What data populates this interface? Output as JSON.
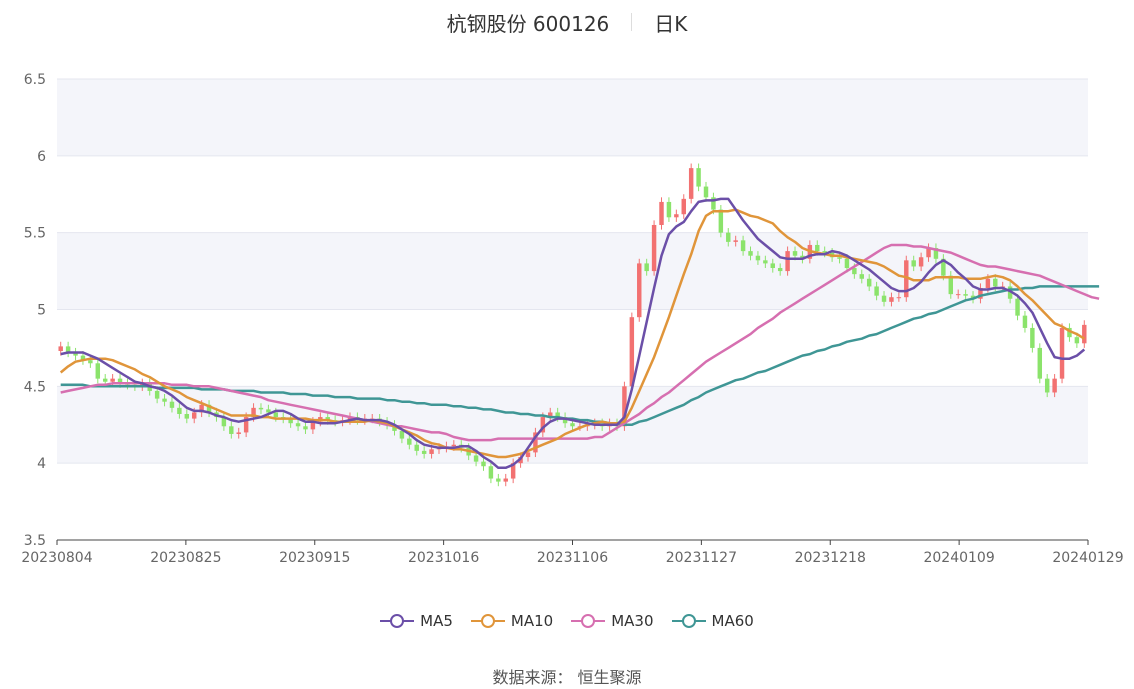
{
  "header": {
    "title": "杭钢股份 600126",
    "period": "日K"
  },
  "source": "数据来源： 恒生聚源",
  "colors": {
    "up": "#f27171",
    "down": "#8be36b",
    "ma5": "#6b4fa8",
    "ma10": "#e0953a",
    "ma30": "#d66fb0",
    "ma60": "#3f9695",
    "grid": "#e4e6ef",
    "band": "#f4f5fa"
  },
  "chart_data": {
    "type": "candlestick",
    "title": "杭钢股份 600126 日K",
    "ylim": [
      3.5,
      6.5
    ],
    "yticks": [
      "3.5",
      "4",
      "4.5",
      "5",
      "5.5",
      "6",
      "6.5"
    ],
    "xticks": [
      "20230804",
      "20230825",
      "20230915",
      "20231016",
      "20231106",
      "20231127",
      "20231218",
      "20240109",
      "20240129"
    ],
    "legend": [
      "MA5",
      "MA10",
      "MA30",
      "MA60"
    ],
    "close": [
      4.76,
      4.72,
      4.7,
      4.67,
      4.65,
      4.55,
      4.53,
      4.55,
      4.52,
      4.51,
      4.5,
      4.52,
      4.47,
      4.42,
      4.4,
      4.36,
      4.32,
      4.29,
      4.33,
      4.38,
      4.33,
      4.3,
      4.24,
      4.19,
      4.2,
      4.3,
      4.36,
      4.35,
      4.33,
      4.3,
      4.29,
      4.26,
      4.24,
      4.22,
      4.27,
      4.3,
      4.28,
      4.27,
      4.28,
      4.3,
      4.28,
      4.29,
      4.29,
      4.27,
      4.25,
      4.21,
      4.16,
      4.12,
      4.08,
      4.06,
      4.09,
      4.1,
      4.11,
      4.12,
      4.1,
      4.05,
      4.01,
      3.98,
      3.9,
      3.88,
      3.9,
      4.0,
      4.04,
      4.07,
      4.2,
      4.3,
      4.33,
      4.3,
      4.26,
      4.24,
      4.24,
      4.25,
      4.26,
      4.24,
      4.26,
      4.24,
      4.5,
      4.95,
      5.3,
      5.25,
      5.55,
      5.7,
      5.6,
      5.62,
      5.72,
      5.92,
      5.8,
      5.73,
      5.65,
      5.5,
      5.44,
      5.45,
      5.38,
      5.35,
      5.32,
      5.3,
      5.27,
      5.25,
      5.38,
      5.35,
      5.33,
      5.42,
      5.38,
      5.37,
      5.34,
      5.33,
      5.27,
      5.23,
      5.2,
      5.15,
      5.09,
      5.05,
      5.08,
      5.08,
      5.32,
      5.28,
      5.34,
      5.4,
      5.33,
      5.22,
      5.1,
      5.1,
      5.09,
      5.07,
      5.14,
      5.2,
      5.15,
      5.15,
      5.07,
      4.96,
      4.88,
      4.75,
      4.55,
      4.46,
      4.55,
      4.88,
      4.82,
      4.78,
      4.9
    ],
    "ma5": [
      4.71,
      4.72,
      4.72,
      4.72,
      4.7,
      4.68,
      4.65,
      4.62,
      4.59,
      4.56,
      4.53,
      4.52,
      4.5,
      4.49,
      4.47,
      4.44,
      4.4,
      4.36,
      4.34,
      4.34,
      4.33,
      4.31,
      4.3,
      4.28,
      4.27,
      4.28,
      4.29,
      4.3,
      4.32,
      4.34,
      4.34,
      4.32,
      4.29,
      4.27,
      4.27,
      4.26,
      4.26,
      4.26,
      4.27,
      4.28,
      4.29,
      4.28,
      4.28,
      4.28,
      4.27,
      4.25,
      4.22,
      4.19,
      4.15,
      4.12,
      4.11,
      4.1,
      4.1,
      4.1,
      4.11,
      4.11,
      4.08,
      4.04,
      4.01,
      3.97,
      3.97,
      3.99,
      4.03,
      4.1,
      4.17,
      4.23,
      4.27,
      4.29,
      4.29,
      4.28,
      4.27,
      4.26,
      4.25,
      4.25,
      4.25,
      4.25,
      4.3,
      4.48,
      4.7,
      4.92,
      5.14,
      5.35,
      5.49,
      5.54,
      5.57,
      5.64,
      5.7,
      5.71,
      5.71,
      5.72,
      5.72,
      5.65,
      5.58,
      5.52,
      5.46,
      5.42,
      5.38,
      5.34,
      5.33,
      5.33,
      5.33,
      5.35,
      5.36,
      5.36,
      5.38,
      5.37,
      5.35,
      5.32,
      5.29,
      5.26,
      5.22,
      5.18,
      5.14,
      5.12,
      5.12,
      5.14,
      5.18,
      5.24,
      5.29,
      5.32,
      5.29,
      5.24,
      5.2,
      5.15,
      5.13,
      5.13,
      5.14,
      5.14,
      5.12,
      5.09,
      5.04,
      4.98,
      4.88,
      4.78,
      4.69,
      4.68,
      4.68,
      4.7,
      4.74
    ],
    "ma10": [
      4.59,
      4.63,
      4.66,
      4.67,
      4.68,
      4.68,
      4.68,
      4.67,
      4.65,
      4.63,
      4.61,
      4.58,
      4.56,
      4.53,
      4.5,
      4.48,
      4.46,
      4.43,
      4.41,
      4.39,
      4.37,
      4.35,
      4.33,
      4.31,
      4.31,
      4.31,
      4.31,
      4.3,
      4.3,
      4.29,
      4.29,
      4.29,
      4.29,
      4.29,
      4.28,
      4.28,
      4.28,
      4.27,
      4.27,
      4.27,
      4.27,
      4.27,
      4.28,
      4.27,
      4.26,
      4.24,
      4.22,
      4.2,
      4.18,
      4.15,
      4.13,
      4.12,
      4.1,
      4.09,
      4.09,
      4.08,
      4.07,
      4.06,
      4.05,
      4.04,
      4.04,
      4.05,
      4.06,
      4.08,
      4.1,
      4.12,
      4.14,
      4.16,
      4.19,
      4.21,
      4.23,
      4.25,
      4.26,
      4.27,
      4.26,
      4.26,
      4.27,
      4.36,
      4.47,
      4.58,
      4.69,
      4.82,
      4.95,
      5.09,
      5.23,
      5.36,
      5.51,
      5.61,
      5.64,
      5.64,
      5.64,
      5.65,
      5.63,
      5.61,
      5.6,
      5.58,
      5.56,
      5.51,
      5.47,
      5.44,
      5.4,
      5.38,
      5.37,
      5.36,
      5.35,
      5.35,
      5.34,
      5.33,
      5.32,
      5.31,
      5.3,
      5.28,
      5.25,
      5.22,
      5.21,
      5.19,
      5.19,
      5.19,
      5.21,
      5.21,
      5.21,
      5.21,
      5.2,
      5.2,
      5.2,
      5.21,
      5.22,
      5.21,
      5.19,
      5.15,
      5.1,
      5.06,
      5.01,
      4.96,
      4.91,
      4.89,
      4.86,
      4.84,
      4.81
    ],
    "ma30": [
      4.46,
      4.47,
      4.48,
      4.49,
      4.5,
      4.51,
      4.51,
      4.52,
      4.52,
      4.52,
      4.52,
      4.52,
      4.52,
      4.52,
      4.52,
      4.51,
      4.51,
      4.51,
      4.5,
      4.5,
      4.5,
      4.49,
      4.48,
      4.47,
      4.46,
      4.45,
      4.44,
      4.43,
      4.41,
      4.4,
      4.39,
      4.38,
      4.37,
      4.36,
      4.35,
      4.34,
      4.33,
      4.32,
      4.31,
      4.3,
      4.29,
      4.28,
      4.27,
      4.26,
      4.25,
      4.24,
      4.24,
      4.23,
      4.22,
      4.21,
      4.2,
      4.2,
      4.19,
      4.17,
      4.16,
      4.15,
      4.15,
      4.15,
      4.15,
      4.16,
      4.16,
      4.16,
      4.16,
      4.16,
      4.16,
      4.16,
      4.16,
      4.16,
      4.16,
      4.16,
      4.16,
      4.16,
      4.17,
      4.17,
      4.2,
      4.23,
      4.26,
      4.29,
      4.32,
      4.36,
      4.39,
      4.43,
      4.46,
      4.5,
      4.54,
      4.58,
      4.62,
      4.66,
      4.69,
      4.72,
      4.75,
      4.78,
      4.81,
      4.84,
      4.88,
      4.91,
      4.94,
      4.98,
      5.01,
      5.04,
      5.07,
      5.1,
      5.13,
      5.16,
      5.19,
      5.22,
      5.25,
      5.28,
      5.31,
      5.34,
      5.37,
      5.4,
      5.42,
      5.42,
      5.42,
      5.41,
      5.41,
      5.4,
      5.39,
      5.38,
      5.37,
      5.35,
      5.33,
      5.31,
      5.29,
      5.28,
      5.28,
      5.27,
      5.26,
      5.25,
      5.24,
      5.23,
      5.22,
      5.2,
      5.18,
      5.16,
      5.14,
      5.12,
      5.1,
      5.08,
      5.07
    ],
    "ma60": [
      4.51,
      4.51,
      4.51,
      4.51,
      4.5,
      4.5,
      4.5,
      4.5,
      4.5,
      4.5,
      4.5,
      4.5,
      4.5,
      4.49,
      4.49,
      4.49,
      4.49,
      4.49,
      4.49,
      4.48,
      4.48,
      4.48,
      4.48,
      4.47,
      4.47,
      4.47,
      4.47,
      4.46,
      4.46,
      4.46,
      4.46,
      4.45,
      4.45,
      4.45,
      4.44,
      4.44,
      4.44,
      4.43,
      4.43,
      4.43,
      4.42,
      4.42,
      4.42,
      4.42,
      4.41,
      4.41,
      4.4,
      4.4,
      4.39,
      4.39,
      4.38,
      4.38,
      4.38,
      4.37,
      4.37,
      4.36,
      4.36,
      4.35,
      4.35,
      4.34,
      4.33,
      4.33,
      4.32,
      4.32,
      4.31,
      4.31,
      4.3,
      4.3,
      4.29,
      4.29,
      4.28,
      4.28,
      4.27,
      4.27,
      4.26,
      4.26,
      4.25,
      4.25,
      4.27,
      4.28,
      4.3,
      4.32,
      4.34,
      4.36,
      4.38,
      4.41,
      4.43,
      4.46,
      4.48,
      4.5,
      4.52,
      4.54,
      4.55,
      4.57,
      4.59,
      4.6,
      4.62,
      4.64,
      4.66,
      4.68,
      4.7,
      4.71,
      4.73,
      4.74,
      4.76,
      4.77,
      4.79,
      4.8,
      4.81,
      4.83,
      4.84,
      4.86,
      4.88,
      4.9,
      4.92,
      4.94,
      4.95,
      4.97,
      4.98,
      5.0,
      5.02,
      5.04,
      5.06,
      5.07,
      5.09,
      5.1,
      5.11,
      5.12,
      5.13,
      5.13,
      5.14,
      5.14,
      5.15,
      5.15,
      5.15,
      5.15,
      5.15,
      5.15,
      5.15,
      5.15,
      5.15
    ]
  }
}
